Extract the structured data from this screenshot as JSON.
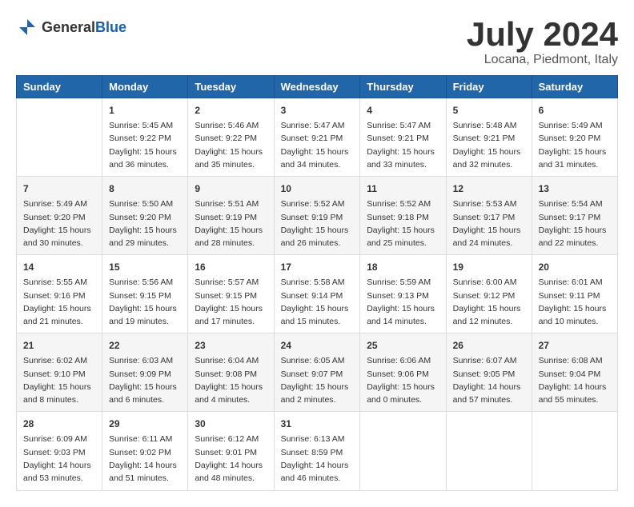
{
  "header": {
    "logo_general": "General",
    "logo_blue": "Blue",
    "month_title": "July 2024",
    "location": "Locana, Piedmont, Italy"
  },
  "weekdays": [
    "Sunday",
    "Monday",
    "Tuesday",
    "Wednesday",
    "Thursday",
    "Friday",
    "Saturday"
  ],
  "weeks": [
    [
      {
        "day": "",
        "sunrise": "",
        "sunset": "",
        "daylight": ""
      },
      {
        "day": "1",
        "sunrise": "Sunrise: 5:45 AM",
        "sunset": "Sunset: 9:22 PM",
        "daylight": "Daylight: 15 hours and 36 minutes."
      },
      {
        "day": "2",
        "sunrise": "Sunrise: 5:46 AM",
        "sunset": "Sunset: 9:22 PM",
        "daylight": "Daylight: 15 hours and 35 minutes."
      },
      {
        "day": "3",
        "sunrise": "Sunrise: 5:47 AM",
        "sunset": "Sunset: 9:21 PM",
        "daylight": "Daylight: 15 hours and 34 minutes."
      },
      {
        "day": "4",
        "sunrise": "Sunrise: 5:47 AM",
        "sunset": "Sunset: 9:21 PM",
        "daylight": "Daylight: 15 hours and 33 minutes."
      },
      {
        "day": "5",
        "sunrise": "Sunrise: 5:48 AM",
        "sunset": "Sunset: 9:21 PM",
        "daylight": "Daylight: 15 hours and 32 minutes."
      },
      {
        "day": "6",
        "sunrise": "Sunrise: 5:49 AM",
        "sunset": "Sunset: 9:20 PM",
        "daylight": "Daylight: 15 hours and 31 minutes."
      }
    ],
    [
      {
        "day": "7",
        "sunrise": "Sunrise: 5:49 AM",
        "sunset": "Sunset: 9:20 PM",
        "daylight": "Daylight: 15 hours and 30 minutes."
      },
      {
        "day": "8",
        "sunrise": "Sunrise: 5:50 AM",
        "sunset": "Sunset: 9:20 PM",
        "daylight": "Daylight: 15 hours and 29 minutes."
      },
      {
        "day": "9",
        "sunrise": "Sunrise: 5:51 AM",
        "sunset": "Sunset: 9:19 PM",
        "daylight": "Daylight: 15 hours and 28 minutes."
      },
      {
        "day": "10",
        "sunrise": "Sunrise: 5:52 AM",
        "sunset": "Sunset: 9:19 PM",
        "daylight": "Daylight: 15 hours and 26 minutes."
      },
      {
        "day": "11",
        "sunrise": "Sunrise: 5:52 AM",
        "sunset": "Sunset: 9:18 PM",
        "daylight": "Daylight: 15 hours and 25 minutes."
      },
      {
        "day": "12",
        "sunrise": "Sunrise: 5:53 AM",
        "sunset": "Sunset: 9:17 PM",
        "daylight": "Daylight: 15 hours and 24 minutes."
      },
      {
        "day": "13",
        "sunrise": "Sunrise: 5:54 AM",
        "sunset": "Sunset: 9:17 PM",
        "daylight": "Daylight: 15 hours and 22 minutes."
      }
    ],
    [
      {
        "day": "14",
        "sunrise": "Sunrise: 5:55 AM",
        "sunset": "Sunset: 9:16 PM",
        "daylight": "Daylight: 15 hours and 21 minutes."
      },
      {
        "day": "15",
        "sunrise": "Sunrise: 5:56 AM",
        "sunset": "Sunset: 9:15 PM",
        "daylight": "Daylight: 15 hours and 19 minutes."
      },
      {
        "day": "16",
        "sunrise": "Sunrise: 5:57 AM",
        "sunset": "Sunset: 9:15 PM",
        "daylight": "Daylight: 15 hours and 17 minutes."
      },
      {
        "day": "17",
        "sunrise": "Sunrise: 5:58 AM",
        "sunset": "Sunset: 9:14 PM",
        "daylight": "Daylight: 15 hours and 15 minutes."
      },
      {
        "day": "18",
        "sunrise": "Sunrise: 5:59 AM",
        "sunset": "Sunset: 9:13 PM",
        "daylight": "Daylight: 15 hours and 14 minutes."
      },
      {
        "day": "19",
        "sunrise": "Sunrise: 6:00 AM",
        "sunset": "Sunset: 9:12 PM",
        "daylight": "Daylight: 15 hours and 12 minutes."
      },
      {
        "day": "20",
        "sunrise": "Sunrise: 6:01 AM",
        "sunset": "Sunset: 9:11 PM",
        "daylight": "Daylight: 15 hours and 10 minutes."
      }
    ],
    [
      {
        "day": "21",
        "sunrise": "Sunrise: 6:02 AM",
        "sunset": "Sunset: 9:10 PM",
        "daylight": "Daylight: 15 hours and 8 minutes."
      },
      {
        "day": "22",
        "sunrise": "Sunrise: 6:03 AM",
        "sunset": "Sunset: 9:09 PM",
        "daylight": "Daylight: 15 hours and 6 minutes."
      },
      {
        "day": "23",
        "sunrise": "Sunrise: 6:04 AM",
        "sunset": "Sunset: 9:08 PM",
        "daylight": "Daylight: 15 hours and 4 minutes."
      },
      {
        "day": "24",
        "sunrise": "Sunrise: 6:05 AM",
        "sunset": "Sunset: 9:07 PM",
        "daylight": "Daylight: 15 hours and 2 minutes."
      },
      {
        "day": "25",
        "sunrise": "Sunrise: 6:06 AM",
        "sunset": "Sunset: 9:06 PM",
        "daylight": "Daylight: 15 hours and 0 minutes."
      },
      {
        "day": "26",
        "sunrise": "Sunrise: 6:07 AM",
        "sunset": "Sunset: 9:05 PM",
        "daylight": "Daylight: 14 hours and 57 minutes."
      },
      {
        "day": "27",
        "sunrise": "Sunrise: 6:08 AM",
        "sunset": "Sunset: 9:04 PM",
        "daylight": "Daylight: 14 hours and 55 minutes."
      }
    ],
    [
      {
        "day": "28",
        "sunrise": "Sunrise: 6:09 AM",
        "sunset": "Sunset: 9:03 PM",
        "daylight": "Daylight: 14 hours and 53 minutes."
      },
      {
        "day": "29",
        "sunrise": "Sunrise: 6:11 AM",
        "sunset": "Sunset: 9:02 PM",
        "daylight": "Daylight: 14 hours and 51 minutes."
      },
      {
        "day": "30",
        "sunrise": "Sunrise: 6:12 AM",
        "sunset": "Sunset: 9:01 PM",
        "daylight": "Daylight: 14 hours and 48 minutes."
      },
      {
        "day": "31",
        "sunrise": "Sunrise: 6:13 AM",
        "sunset": "Sunset: 8:59 PM",
        "daylight": "Daylight: 14 hours and 46 minutes."
      },
      {
        "day": "",
        "sunrise": "",
        "sunset": "",
        "daylight": ""
      },
      {
        "day": "",
        "sunrise": "",
        "sunset": "",
        "daylight": ""
      },
      {
        "day": "",
        "sunrise": "",
        "sunset": "",
        "daylight": ""
      }
    ]
  ]
}
